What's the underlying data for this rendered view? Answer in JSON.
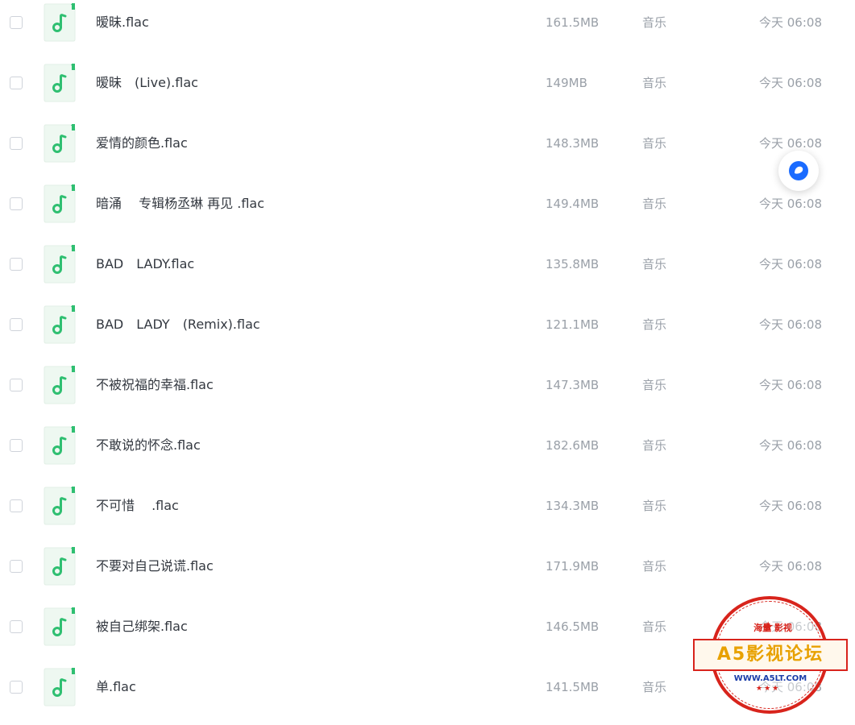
{
  "file_type_icon": "music-note-icon",
  "colors": {
    "icon_bg": "#eef8f1",
    "icon_accent": "#2fbf71",
    "text_primary": "#333840",
    "text_secondary": "#9aa0a8",
    "float_button_accent": "#1a6bff",
    "watermark_red": "#d8241c",
    "watermark_gold": "#e8a100",
    "watermark_blue": "#1a3ca8"
  },
  "files": [
    {
      "name": "暧昧.flac",
      "size": "161.5MB",
      "type": "音乐",
      "time": "今天 06:08"
    },
    {
      "name": "暧昧　(Live).flac",
      "size": "149MB",
      "type": "音乐",
      "time": "今天 06:08"
    },
    {
      "name": "爱情的颜色.flac",
      "size": "148.3MB",
      "type": "音乐",
      "time": "今天 06:08"
    },
    {
      "name": "暗涌　 专辑杨丞琳 再见 .flac",
      "size": "149.4MB",
      "type": "音乐",
      "time": "今天 06:08"
    },
    {
      "name": "BAD　LADY.flac",
      "size": "135.8MB",
      "type": "音乐",
      "time": "今天 06:08"
    },
    {
      "name": "BAD　LADY　(Remix).flac",
      "size": "121.1MB",
      "type": "音乐",
      "time": "今天 06:08"
    },
    {
      "name": "不被祝福的幸福.flac",
      "size": "147.3MB",
      "type": "音乐",
      "time": "今天 06:08"
    },
    {
      "name": "不敢说的怀念.flac",
      "size": "182.6MB",
      "type": "音乐",
      "time": "今天 06:08"
    },
    {
      "name": "不可惜　 .flac",
      "size": "134.3MB",
      "type": "音乐",
      "time": "今天 06:08"
    },
    {
      "name": "不要对自己说谎.flac",
      "size": "171.9MB",
      "type": "音乐",
      "time": "今天 06:08"
    },
    {
      "name": "被自己绑架.flac",
      "size": "146.5MB",
      "type": "音乐",
      "time": "今天 06:08"
    },
    {
      "name": "单.flac",
      "size": "141.5MB",
      "type": "音乐",
      "time": "今天 06:08"
    }
  ],
  "floating_button": {
    "icon": "chat-bubble-icon"
  },
  "watermark": {
    "top_text": "海量 影视",
    "main_text": "A5影视论坛",
    "url": "WWW.A5LT.COM"
  }
}
